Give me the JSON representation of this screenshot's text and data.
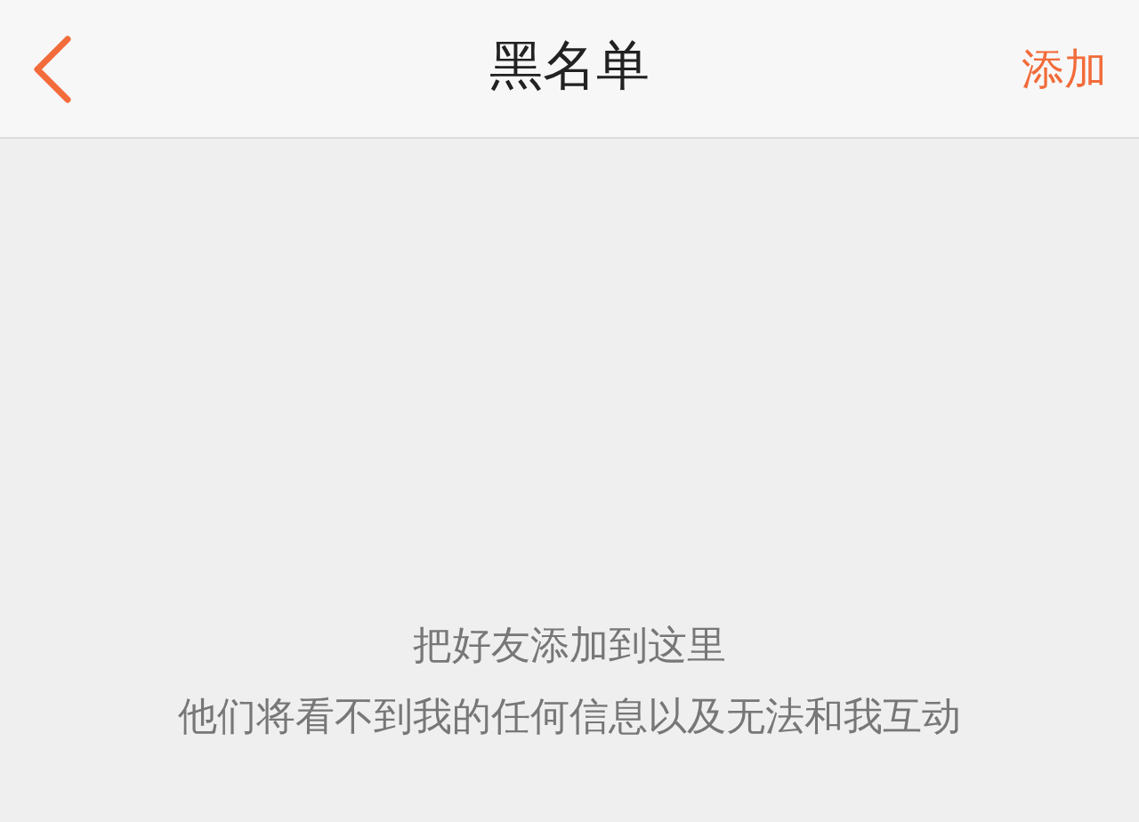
{
  "nav_bar": {
    "title": "黑名单",
    "action": "添加"
  },
  "empty_state": {
    "lines": [
      "把好友添加到这里",
      "他们将看不到我的任何信息以及无法和我互动"
    ]
  }
}
